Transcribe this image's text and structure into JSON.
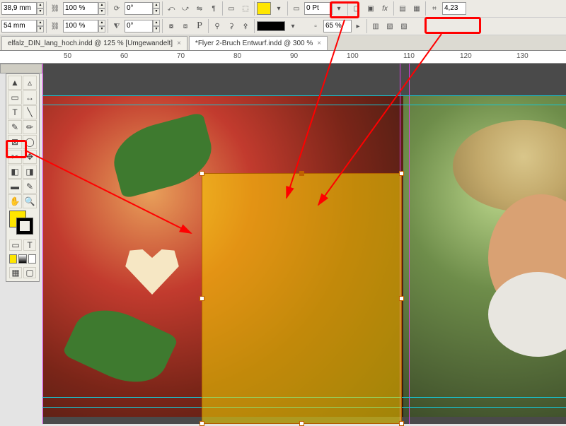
{
  "toolbar": {
    "width_value": "38,9 mm",
    "height_value": "54 mm",
    "scale_x": "100 %",
    "scale_y": "100 %",
    "rotate": "0°",
    "shear": "0°",
    "stroke_weight": "0 Pt",
    "opacity": "65 %",
    "extra_value": "4,23",
    "fill_color": "#ffe600"
  },
  "tabs": [
    {
      "label": "elfalz_DIN_lang_hoch.indd @ 125 % [Umgewandelt]",
      "active": false
    },
    {
      "label": "*Flyer 2-Bruch Entwurf.indd @ 300 %",
      "active": true
    }
  ],
  "ruler_marks": [
    "50",
    "60",
    "70",
    "80",
    "90",
    "100",
    "110",
    "120",
    "130"
  ],
  "toolbox": {
    "fill": "#ffe600",
    "stroke": "#ffffff"
  },
  "selection": {
    "opacity_pct": 65
  }
}
